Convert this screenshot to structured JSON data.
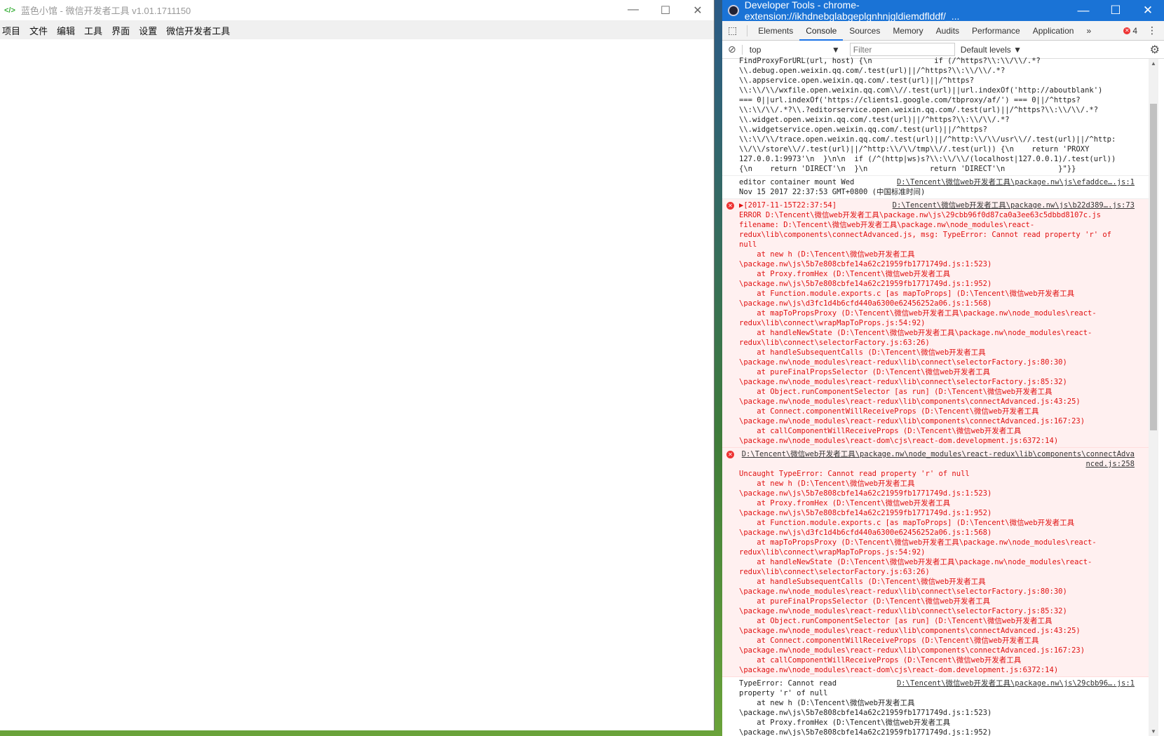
{
  "left_window": {
    "title": "蓝色小馆 - 微信开发者工具 v1.01.1711150",
    "menu": [
      "项目",
      "文件",
      "编辑",
      "工具",
      "界面",
      "设置",
      "微信开发者工具"
    ]
  },
  "devtools": {
    "title": "Developer Tools - chrome-extension://ikhdnebglabgeplgnhnjgldiemdflddf/_...",
    "tabs": [
      "Elements",
      "Console",
      "Sources",
      "Memory",
      "Audits",
      "Performance",
      "Application"
    ],
    "active_tab": "Console",
    "more": "»",
    "error_count": "4",
    "context": "top",
    "filter_placeholder": "Filter",
    "levels": "Default levels"
  },
  "messages": [
    {
      "type": "log",
      "link": "",
      "lines": [
        "FindProxyForURL(url, host) {\\n              if (/^https?\\\\:\\\\/\\\\/.*?",
        "\\\\.debug.open.weixin.qq.com/.test(url)||/^https?\\\\:\\\\/\\\\/.*?",
        "\\\\.appservice.open.weixin.qq.com/.test(url)||/^https?",
        "\\\\:\\\\/\\\\/wxfile.open.weixin.qq.com\\\\//.test(url)||url.indexOf('http://aboutblank')",
        "=== 0||url.indexOf('https://clients1.google.com/tbproxy/af/') === 0||/^https?",
        "\\\\:\\\\/\\\\/.*?\\\\.?editorservice.open.weixin.qq.com/.test(url)||/^https?\\\\:\\\\/\\\\/.*?",
        "\\\\.widget.open.weixin.qq.com/.test(url)||/^https?\\\\:\\\\/\\\\/.*?",
        "\\\\.widgetservice.open.weixin.qq.com/.test(url)||/^https?",
        "\\\\:\\\\/\\\\/trace.open.weixin.qq.com/.test(url)||/^http:\\\\/\\\\/usr\\\\//.test(url)||/^http:",
        "\\\\/\\\\/store\\\\//.test(url)||/^http:\\\\/\\\\/tmp\\\\//.test(url)) {\\n    return 'PROXY",
        "127.0.0.1:9973'\\n  }\\n\\n  if (/^(http|ws)s?\\\\:\\\\/\\\\/(localhost|127.0.0.1)/.test(url))",
        "{\\n    return 'DIRECT'\\n  }\\n              return 'DIRECT'\\n            }\"}}"
      ]
    },
    {
      "type": "log",
      "link": "D:\\Tencent\\微信web开发者工具\\package.nw\\js\\efaddce….js:1",
      "lines": [
        "editor container mount Wed",
        "Nov 15 2017 22:37:53 GMT+0800 (中国标准时间)"
      ]
    },
    {
      "type": "error",
      "link": "D:\\Tencent\\微信web开发者工具\\package.nw\\js\\b22d389….js:73",
      "lines": [
        "▶[2017-11-15T22:37:54]",
        "ERROR D:\\Tencent\\微信web开发者工具\\package.nw\\js\\29cbb96f0d87ca0a3ee63c5dbbd8107c.js",
        "filename: D:\\Tencent\\微信web开发者工具\\package.nw\\node_modules\\react-",
        "redux\\lib\\components\\connectAdvanced.js, msg: TypeError: Cannot read property 'r' of",
        "null",
        "    at new h (D:\\Tencent\\微信web开发者工具",
        "\\package.nw\\js\\5b7e808cbfe14a62c21959fb1771749d.js:1:523)",
        "    at Proxy.fromHex (D:\\Tencent\\微信web开发者工具",
        "\\package.nw\\js\\5b7e808cbfe14a62c21959fb1771749d.js:1:952)",
        "    at Function.module.exports.c [as mapToProps] (D:\\Tencent\\微信web开发者工具",
        "\\package.nw\\js\\d3fc1d4b6cfd440a6300e62456252a06.js:1:568)",
        "    at mapToPropsProxy (D:\\Tencent\\微信web开发者工具\\package.nw\\node_modules\\react-",
        "redux\\lib\\connect\\wrapMapToProps.js:54:92)",
        "    at handleNewState (D:\\Tencent\\微信web开发者工具\\package.nw\\node_modules\\react-",
        "redux\\lib\\connect\\selectorFactory.js:63:26)",
        "    at handleSubsequentCalls (D:\\Tencent\\微信web开发者工具",
        "\\package.nw\\node_modules\\react-redux\\lib\\connect\\selectorFactory.js:80:30)",
        "    at pureFinalPropsSelector (D:\\Tencent\\微信web开发者工具",
        "\\package.nw\\node_modules\\react-redux\\lib\\connect\\selectorFactory.js:85:32)",
        "    at Object.runComponentSelector [as run] (D:\\Tencent\\微信web开发者工具",
        "\\package.nw\\node_modules\\react-redux\\lib\\components\\connectAdvanced.js:43:25)",
        "    at Connect.componentWillReceiveProps (D:\\Tencent\\微信web开发者工具",
        "\\package.nw\\node_modules\\react-redux\\lib\\components\\connectAdvanced.js:167:23)",
        "    at callComponentWillReceiveProps (D:\\Tencent\\微信web开发者工具",
        "\\package.nw\\node_modules\\react-dom\\cjs\\react-dom.development.js:6372:14)"
      ]
    },
    {
      "type": "error",
      "link": "D:\\Tencent\\微信web开发者工具\\package.nw\\node_modules\\react-redux\\lib\\components\\connectAdvanced.js:258",
      "lines": [
        "Uncaught TypeError: Cannot read property 'r' of null",
        "    at new h (D:\\Tencent\\微信web开发者工具",
        "\\package.nw\\js\\5b7e808cbfe14a62c21959fb1771749d.js:1:523)",
        "    at Proxy.fromHex (D:\\Tencent\\微信web开发者工具",
        "\\package.nw\\js\\5b7e808cbfe14a62c21959fb1771749d.js:1:952)",
        "    at Function.module.exports.c [as mapToProps] (D:\\Tencent\\微信web开发者工具",
        "\\package.nw\\js\\d3fc1d4b6cfd440a6300e62456252a06.js:1:568)",
        "    at mapToPropsProxy (D:\\Tencent\\微信web开发者工具\\package.nw\\node_modules\\react-",
        "redux\\lib\\connect\\wrapMapToProps.js:54:92)",
        "    at handleNewState (D:\\Tencent\\微信web开发者工具\\package.nw\\node_modules\\react-",
        "redux\\lib\\connect\\selectorFactory.js:63:26)",
        "    at handleSubsequentCalls (D:\\Tencent\\微信web开发者工具",
        "\\package.nw\\node_modules\\react-redux\\lib\\connect\\selectorFactory.js:80:30)",
        "    at pureFinalPropsSelector (D:\\Tencent\\微信web开发者工具",
        "\\package.nw\\node_modules\\react-redux\\lib\\connect\\selectorFactory.js:85:32)",
        "    at Object.runComponentSelector [as run] (D:\\Tencent\\微信web开发者工具",
        "\\package.nw\\node_modules\\react-redux\\lib\\components\\connectAdvanced.js:43:25)",
        "    at Connect.componentWillReceiveProps (D:\\Tencent\\微信web开发者工具",
        "\\package.nw\\node_modules\\react-redux\\lib\\components\\connectAdvanced.js:167:23)",
        "    at callComponentWillReceiveProps (D:\\Tencent\\微信web开发者工具",
        "\\package.nw\\node_modules\\react-dom\\cjs\\react-dom.development.js:6372:14)"
      ]
    },
    {
      "type": "log",
      "link": "D:\\Tencent\\微信web开发者工具\\package.nw\\js\\29cbb96….js:1",
      "lines": [
        "TypeError: Cannot read",
        "property 'r' of null",
        "    at new h (D:\\Tencent\\微信web开发者工具",
        "\\package.nw\\js\\5b7e808cbfe14a62c21959fb1771749d.js:1:523)",
        "    at Proxy.fromHex (D:\\Tencent\\微信web开发者工具",
        "\\package.nw\\js\\5b7e808cbfe14a62c21959fb1771749d.js:1:952)"
      ]
    }
  ]
}
